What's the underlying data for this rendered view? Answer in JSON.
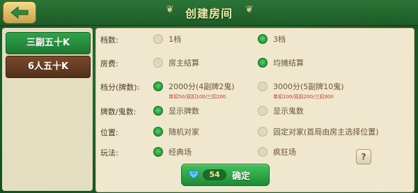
{
  "header": {
    "title": "创建房间"
  },
  "tabs": [
    {
      "label": "三副五十K",
      "active": true
    },
    {
      "label": "6人五十K",
      "active": false
    }
  ],
  "rows": [
    {
      "label": "档数:",
      "options": [
        {
          "text": "1档",
          "selected": false
        },
        {
          "text": "3档",
          "selected": true
        }
      ]
    },
    {
      "label": "房费:",
      "options": [
        {
          "text": "房主结算",
          "selected": false
        },
        {
          "text": "均摊结算",
          "selected": true
        }
      ]
    },
    {
      "label": "档分(牌数):",
      "options": [
        {
          "text": "2000分(4副牌2鬼)",
          "selected": true,
          "note": "单扣50/双扣100/三扣200"
        },
        {
          "text": "3000分(5副牌10鬼)",
          "selected": false,
          "note": "单扣100/双扣200/三扣300"
        }
      ]
    },
    {
      "label": "牌数/鬼数:",
      "options": [
        {
          "text": "显示牌数",
          "selected": true
        },
        {
          "text": "显示鬼数",
          "selected": false
        }
      ]
    },
    {
      "label": "位置:",
      "options": [
        {
          "text": "随机对家",
          "selected": true
        },
        {
          "text": "固定对家(首局由房主选择位置)",
          "selected": false
        }
      ]
    },
    {
      "label": "玩法:",
      "options": [
        {
          "text": "经典场",
          "selected": true
        },
        {
          "text": "疯狂场",
          "selected": false
        }
      ]
    }
  ],
  "help": {
    "label": "?"
  },
  "confirm": {
    "cost": "54",
    "label": "确定"
  },
  "colors": {
    "accent_green": "#2a9e3d",
    "panel_bg": "#efe8cf",
    "note_red": "#c13b2b"
  }
}
